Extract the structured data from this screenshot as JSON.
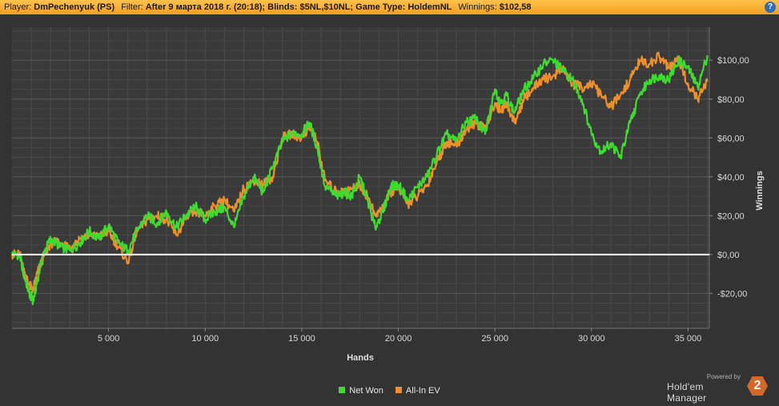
{
  "header": {
    "player_label": "Player:",
    "player_value": "DmPechenyuk (PS)",
    "filter_label": "Filter:",
    "filter_value": "After 9 марта 2018 г. (20:18); Blinds: $5NL,$10NL; Game Type: HoldemNL",
    "winnings_label": "Winnings:",
    "winnings_value": "$102,58",
    "help_glyph": "?"
  },
  "chart_data": {
    "type": "line",
    "xlabel": "Hands",
    "ylabel": "Winnings",
    "xlim": [
      0,
      36100
    ],
    "ylim": [
      -38,
      117
    ],
    "x_ticks": [
      5000,
      10000,
      15000,
      20000,
      25000,
      30000,
      35000
    ],
    "x_tick_labels": [
      "5 000",
      "10 000",
      "15 000",
      "20 000",
      "25 000",
      "30 000",
      "35 000"
    ],
    "y_ticks": [
      -20,
      0,
      20,
      40,
      60,
      80,
      100
    ],
    "y_tick_labels": [
      "-$20,00",
      "$0,00",
      "$20,00",
      "$40,00",
      "$60,00",
      "$80,00",
      "$100,00"
    ],
    "grid": true,
    "legend_position": "bottom-center",
    "zero_line_color": "#ffffff",
    "series": [
      {
        "name": "Net Won",
        "color": "#3ddc2f",
        "x": [
          0,
          400,
          600,
          900,
          1100,
          1300,
          1600,
          2000,
          2500,
          3000,
          3500,
          4000,
          4500,
          5000,
          5500,
          6000,
          6500,
          7000,
          7500,
          8000,
          8500,
          9000,
          9500,
          10000,
          10500,
          11000,
          11500,
          12000,
          12500,
          13000,
          13500,
          14000,
          14500,
          15000,
          15400,
          15800,
          16200,
          16800,
          17200,
          17600,
          18000,
          18400,
          18800,
          19200,
          19600,
          20000,
          20500,
          21000,
          21500,
          22000,
          22500,
          23000,
          23500,
          24000,
          24500,
          25000,
          25300,
          25600,
          26000,
          26500,
          27000,
          27500,
          28000,
          28500,
          29000,
          29500,
          30000,
          30500,
          31000,
          31500,
          32000,
          32500,
          33000,
          33500,
          34000,
          34500,
          35000,
          35500,
          36000
        ],
        "y": [
          0,
          0,
          -10,
          -20,
          -24,
          -14,
          0,
          8,
          4,
          2,
          6,
          12,
          8,
          15,
          6,
          2,
          13,
          20,
          16,
          22,
          14,
          20,
          25,
          18,
          22,
          24,
          14,
          30,
          40,
          32,
          45,
          58,
          63,
          62,
          68,
          55,
          35,
          30,
          32,
          30,
          40,
          28,
          14,
          22,
          35,
          36,
          28,
          35,
          40,
          52,
          62,
          58,
          68,
          70,
          62,
          85,
          78,
          82,
          73,
          85,
          91,
          98,
          100,
          95,
          90,
          80,
          62,
          53,
          57,
          50,
          68,
          82,
          90,
          92,
          90,
          100,
          96,
          86,
          102.58
        ]
      },
      {
        "name": "All-In EV",
        "color": "#ee8f2c",
        "x": [
          0,
          400,
          600,
          900,
          1100,
          1300,
          1600,
          2000,
          2500,
          3000,
          3500,
          4000,
          4500,
          5000,
          5500,
          6000,
          6500,
          7000,
          7500,
          8000,
          8500,
          9000,
          9500,
          10000,
          10500,
          11000,
          11500,
          12000,
          12500,
          13000,
          13500,
          14000,
          14500,
          15000,
          15400,
          15800,
          16200,
          16800,
          17200,
          17600,
          18000,
          18400,
          18800,
          19200,
          19600,
          20000,
          20500,
          21000,
          21500,
          22000,
          22500,
          23000,
          23500,
          24000,
          24500,
          25000,
          25300,
          25600,
          26000,
          26500,
          27000,
          27500,
          28000,
          28500,
          29000,
          29500,
          30000,
          30500,
          31000,
          31500,
          32000,
          32500,
          33000,
          33500,
          34000,
          34500,
          35000,
          35500,
          36000
        ],
        "y": [
          0,
          0,
          -8,
          -16,
          -18,
          -10,
          -2,
          6,
          6,
          4,
          8,
          10,
          9,
          12,
          4,
          -4,
          12,
          18,
          20,
          18,
          10,
          18,
          22,
          20,
          25,
          28,
          22,
          34,
          38,
          36,
          40,
          60,
          62,
          60,
          66,
          58,
          38,
          32,
          32,
          34,
          36,
          30,
          20,
          24,
          32,
          34,
          26,
          30,
          36,
          48,
          58,
          56,
          64,
          68,
          64,
          78,
          74,
          78,
          68,
          80,
          86,
          90,
          92,
          96,
          88,
          86,
          88,
          82,
          76,
          82,
          90,
          100,
          98,
          102,
          96,
          100,
          88,
          80,
          89
        ]
      }
    ]
  },
  "branding": {
    "powered_by": "Powered by",
    "product": "Hold'em Manager",
    "logo_glyph": "2"
  }
}
